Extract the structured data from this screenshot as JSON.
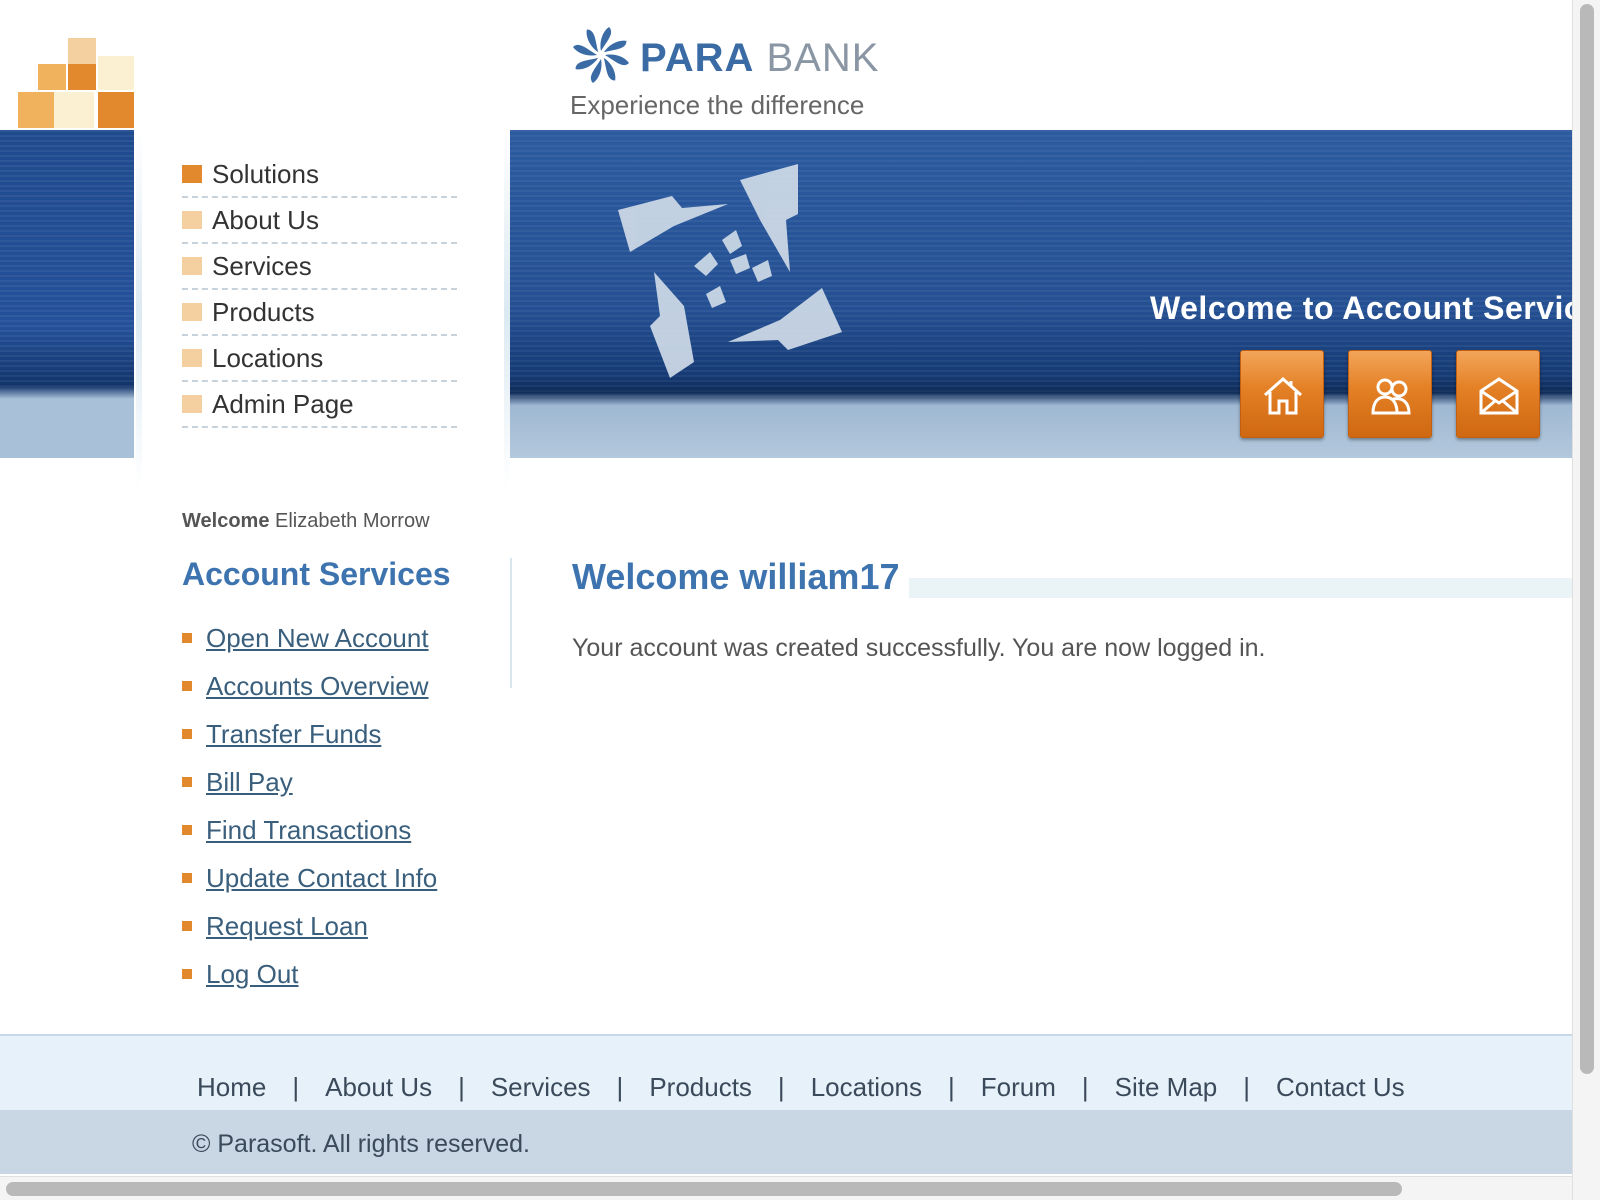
{
  "brand": {
    "name_part1": "PARA",
    "name_part2": "BANK",
    "tagline": "Experience the difference"
  },
  "header": {
    "banner_title": "Welcome to Account Servic",
    "quick_buttons": [
      {
        "icon": "home-icon"
      },
      {
        "icon": "about-icon"
      },
      {
        "icon": "contact-icon"
      }
    ]
  },
  "topnav": {
    "items": [
      {
        "label": "Solutions"
      },
      {
        "label": "About Us"
      },
      {
        "label": "Services"
      },
      {
        "label": "Products"
      },
      {
        "label": "Locations"
      },
      {
        "label": "Admin Page"
      }
    ]
  },
  "sidebar": {
    "welcome_label": "Welcome",
    "user_name": "Elizabeth Morrow",
    "title": "Account Services",
    "links": [
      {
        "label": "Open New Account"
      },
      {
        "label": "Accounts Overview"
      },
      {
        "label": "Transfer Funds"
      },
      {
        "label": "Bill Pay"
      },
      {
        "label": "Find Transactions"
      },
      {
        "label": "Update Contact Info"
      },
      {
        "label": "Request Loan"
      },
      {
        "label": "Log Out"
      }
    ]
  },
  "main": {
    "title": "Welcome william17",
    "message": "Your account was created successfully. You are now logged in."
  },
  "footer": {
    "links": [
      {
        "label": "Home"
      },
      {
        "label": "About Us"
      },
      {
        "label": "Services"
      },
      {
        "label": "Products"
      },
      {
        "label": "Locations"
      },
      {
        "label": "Forum"
      },
      {
        "label": "Site Map"
      },
      {
        "label": "Contact Us"
      }
    ],
    "separator": "|",
    "copyright": "© Parasoft. All rights reserved."
  },
  "colors": {
    "accent_orange": "#e2892e",
    "brand_blue": "#3d73ae",
    "banner_blue": "#244f92"
  }
}
